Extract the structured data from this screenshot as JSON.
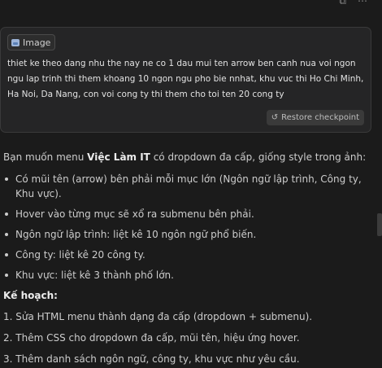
{
  "prompt": {
    "attachment_label": "Image",
    "text": "thiet ke theo dang nhu the nay ne co 1 dau mui ten arrow ben canh nua voi ngon ngu lap trinh thi them khoang 10 ngon ngu pho bie nnhat, khu vuc thi Ho Chi Minh, Ha Noi, Da Nang, con voi cong ty thi them cho toi ten 20 cong ty",
    "restore_label": "Restore checkpoint"
  },
  "response": {
    "intro_prefix": "Bạn muốn menu ",
    "intro_bold": "Việc Làm IT",
    "intro_suffix": " có dropdown đa cấp, giống style trong ảnh:",
    "bullets": [
      "Có mũi tên (arrow) bên phải mỗi mục lớn (Ngôn ngữ lập trình, Công ty, Khu vực).",
      "Hover vào từng mục sẽ xổ ra submenu bên phải.",
      "Ngôn ngữ lập trình: liệt kê 10 ngôn ngữ phổ biến.",
      "Công ty: liệt kê 20 công ty.",
      "Khu vực: liệt kê 3 thành phố lớn."
    ],
    "plan_heading": "Kế hoạch:",
    "steps": [
      "1. Sửa HTML menu thành dạng đa cấp (dropdown + submenu).",
      "2. Thêm CSS cho dropdown đa cấp, mũi tên, hiệu ứng hover.",
      "3. Thêm danh sách ngôn ngữ, công ty, khu vực như yêu cầu."
    ]
  },
  "icons": {
    "copy": "copy-icon",
    "more": "more-icon",
    "image": "image-icon",
    "restore": "restore-icon"
  }
}
